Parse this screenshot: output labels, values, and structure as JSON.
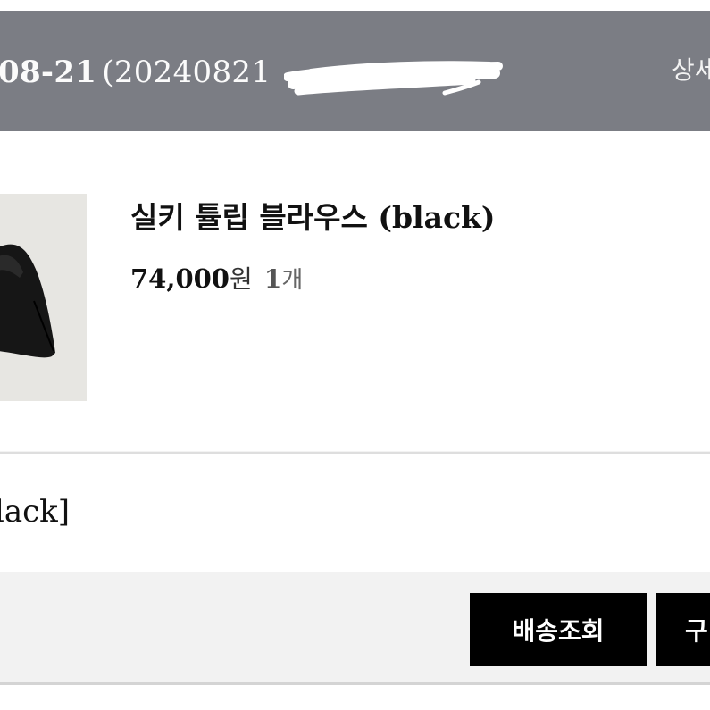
{
  "order": {
    "date_partial": "08-21",
    "number_partial": "(20240821",
    "detail_label": "상세"
  },
  "product": {
    "name": "실키 튤립 블라우스 (black)",
    "price": "74,000",
    "currency": "원",
    "quantity": "1",
    "quantity_unit": "개"
  },
  "option": {
    "text": "lack]"
  },
  "actions": {
    "track_label": "배송조회",
    "second_label_partial": "구"
  },
  "colors": {
    "header_bg": "#7b7d84",
    "button_bg": "#000000"
  },
  "icons": {
    "thumbnail": "product-blouse-image",
    "redaction": "scribble-redaction"
  }
}
